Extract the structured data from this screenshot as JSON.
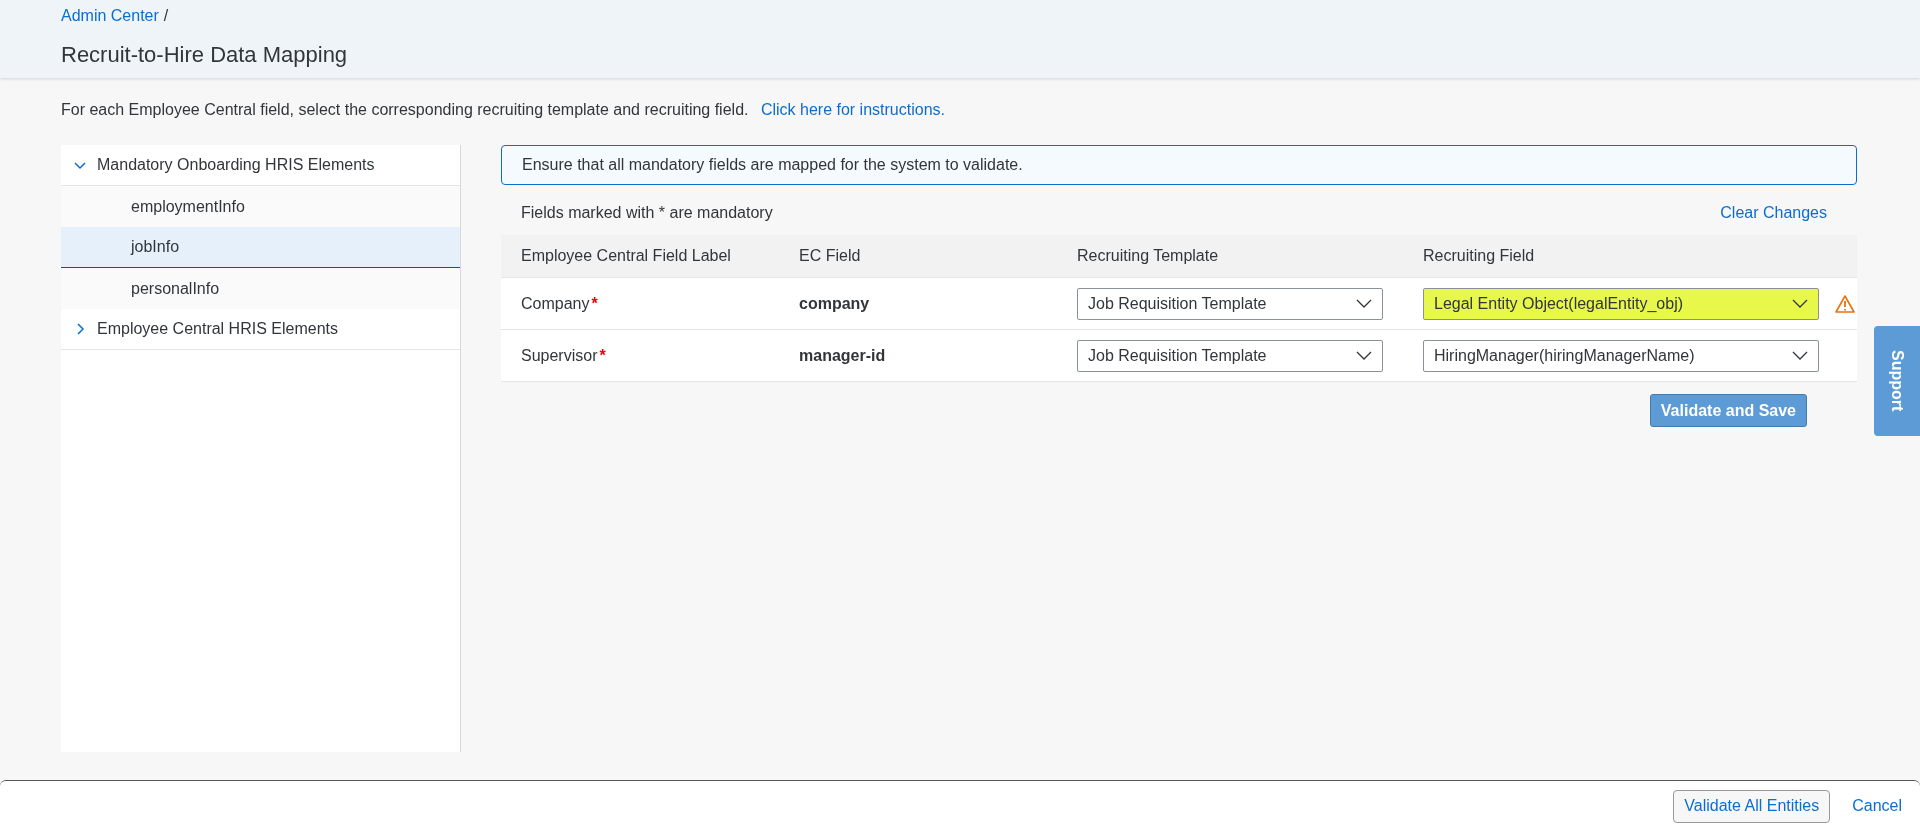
{
  "breadcrumb": {
    "link": "Admin Center",
    "separator": "/"
  },
  "title": "Recruit-to-Hire Data Mapping",
  "intro": {
    "text": "For each Employee Central field, select the corresponding recruiting template and recruiting field.",
    "link": "Click here for instructions."
  },
  "tree": [
    {
      "label": "Mandatory Onboarding HRIS Elements",
      "expanded": true,
      "children": [
        {
          "label": "employmentInfo",
          "selected": false
        },
        {
          "label": "jobInfo",
          "selected": true
        },
        {
          "label": "personalInfo",
          "selected": false
        }
      ]
    },
    {
      "label": "Employee Central HRIS Elements",
      "expanded": false
    }
  ],
  "message": "Ensure that all mandatory fields are mapped for the system to validate.",
  "mandatory_note": "Fields marked with * are mandatory",
  "clear_changes": "Clear Changes",
  "table": {
    "columns": [
      "Employee Central Field Label",
      "EC Field",
      "Recruiting Template",
      "Recruiting Field"
    ],
    "rows": [
      {
        "label": "Company",
        "required_mark": "*",
        "ec_field": "company",
        "template": "Job Requisition Template",
        "field": "Legal Entity Object(legalEntity_obj)",
        "warning": true,
        "highlighted": true
      },
      {
        "label": "Supervisor",
        "required_mark": "*",
        "ec_field": "manager-id",
        "template": "Job Requisition Template",
        "field": "HiringManager(hiringManagerName)",
        "warning": false,
        "highlighted": false
      }
    ]
  },
  "validate_save": "Validate and Save",
  "support_tab": "Support",
  "footer": {
    "buttons": [
      {
        "label": "Validate All Entities",
        "kind": "secondary"
      },
      {
        "label": "Cancel",
        "kind": "link"
      }
    ]
  }
}
